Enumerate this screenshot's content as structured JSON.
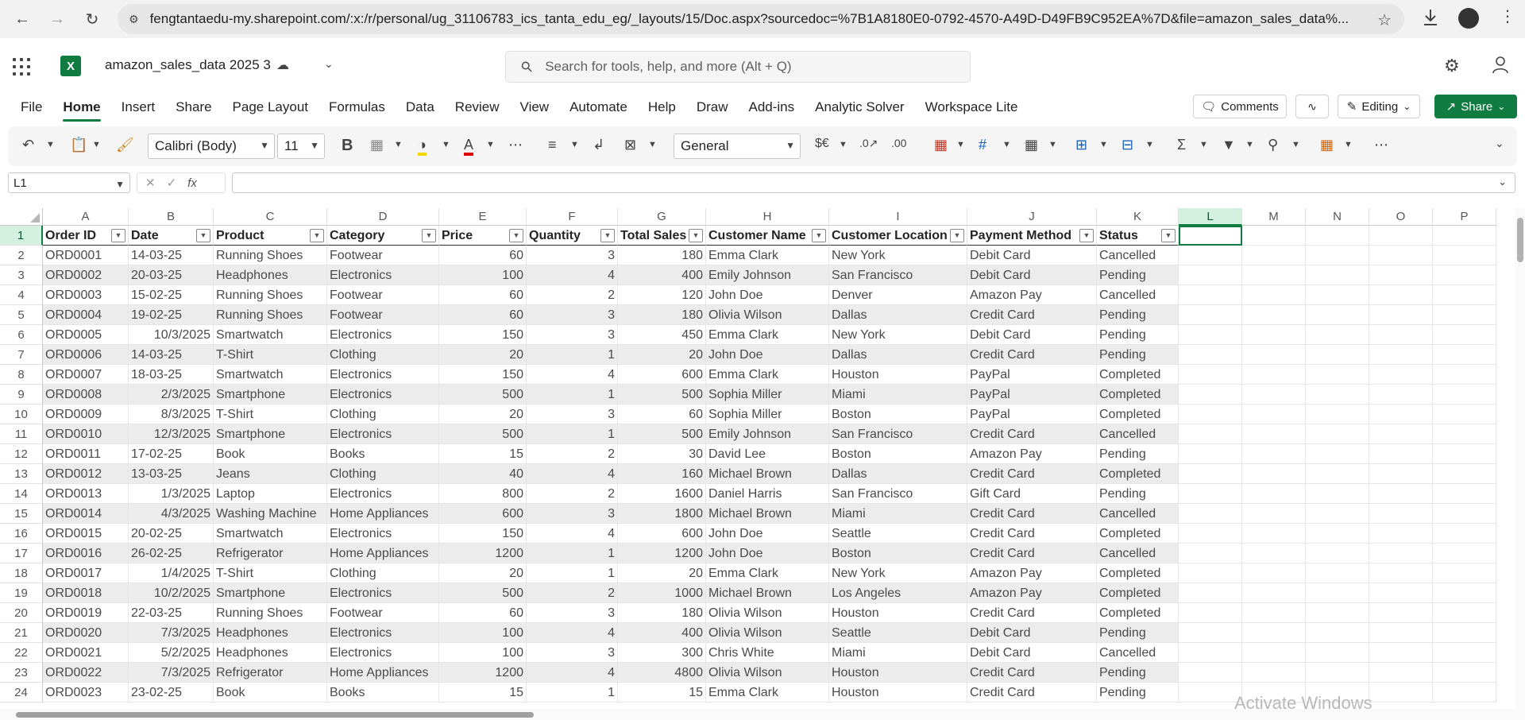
{
  "browser": {
    "url": "fengtantaedu-my.sharepoint.com/:x:/r/personal/ug_31106783_ics_tanta_edu_eg/_layouts/15/Doc.aspx?sourcedoc=%7B1A8180E0-0792-4570-A49D-D49FB9C952EA%7D&file=amazon_sales_data%..."
  },
  "app": {
    "doc_title": "amazon_sales_data 2025 3",
    "search_placeholder": "Search for tools, help, and more (Alt + Q)"
  },
  "menu": [
    "File",
    "Home",
    "Insert",
    "Share",
    "Page Layout",
    "Formulas",
    "Data",
    "Review",
    "View",
    "Automate",
    "Help",
    "Draw",
    "Add-ins",
    "Analytic Solver",
    "Workspace Lite"
  ],
  "menu_active": "Home",
  "actions": {
    "comments": "Comments",
    "editing": "Editing",
    "share": "Share"
  },
  "ribbon": {
    "font": "Calibri (Body)",
    "size": "11",
    "number_format": "General",
    "currency": "$€"
  },
  "formula_bar": {
    "name_box": "L1",
    "fx": "fx",
    "value": ""
  },
  "grid": {
    "columns": [
      "A",
      "B",
      "C",
      "D",
      "E",
      "F",
      "G",
      "H",
      "I",
      "J",
      "K",
      "L",
      "M",
      "N",
      "O",
      "P"
    ],
    "selected_column": "L",
    "selected_row": "1",
    "headers": [
      "Order ID",
      "Date",
      "Product",
      "Category",
      "Price",
      "Quantity",
      "Total Sales",
      "Customer Name",
      "Customer Location",
      "Payment Method",
      "Status"
    ],
    "rows": [
      [
        "ORD0001",
        "14-03-25",
        "Running Shoes",
        "Footwear",
        "60",
        "3",
        "180",
        "Emma Clark",
        "New York",
        "Debit Card",
        "Cancelled"
      ],
      [
        "ORD0002",
        "20-03-25",
        "Headphones",
        "Electronics",
        "100",
        "4",
        "400",
        "Emily Johnson",
        "San Francisco",
        "Debit Card",
        "Pending"
      ],
      [
        "ORD0003",
        "15-02-25",
        "Running Shoes",
        "Footwear",
        "60",
        "2",
        "120",
        "John Doe",
        "Denver",
        "Amazon Pay",
        "Cancelled"
      ],
      [
        "ORD0004",
        "19-02-25",
        "Running Shoes",
        "Footwear",
        "60",
        "3",
        "180",
        "Olivia Wilson",
        "Dallas",
        "Credit Card",
        "Pending"
      ],
      [
        "ORD0005",
        "10/3/2025",
        "Smartwatch",
        "Electronics",
        "150",
        "3",
        "450",
        "Emma Clark",
        "New York",
        "Debit Card",
        "Pending"
      ],
      [
        "ORD0006",
        "14-03-25",
        "T-Shirt",
        "Clothing",
        "20",
        "1",
        "20",
        "John Doe",
        "Dallas",
        "Credit Card",
        "Pending"
      ],
      [
        "ORD0007",
        "18-03-25",
        "Smartwatch",
        "Electronics",
        "150",
        "4",
        "600",
        "Emma Clark",
        "Houston",
        "PayPal",
        "Completed"
      ],
      [
        "ORD0008",
        "2/3/2025",
        "Smartphone",
        "Electronics",
        "500",
        "1",
        "500",
        "Sophia Miller",
        "Miami",
        "PayPal",
        "Completed"
      ],
      [
        "ORD0009",
        "8/3/2025",
        "T-Shirt",
        "Clothing",
        "20",
        "3",
        "60",
        "Sophia Miller",
        "Boston",
        "PayPal",
        "Completed"
      ],
      [
        "ORD0010",
        "12/3/2025",
        "Smartphone",
        "Electronics",
        "500",
        "1",
        "500",
        "Emily Johnson",
        "San Francisco",
        "Credit Card",
        "Cancelled"
      ],
      [
        "ORD0011",
        "17-02-25",
        "Book",
        "Books",
        "15",
        "2",
        "30",
        "David Lee",
        "Boston",
        "Amazon Pay",
        "Pending"
      ],
      [
        "ORD0012",
        "13-03-25",
        "Jeans",
        "Clothing",
        "40",
        "4",
        "160",
        "Michael Brown",
        "Dallas",
        "Credit Card",
        "Completed"
      ],
      [
        "ORD0013",
        "1/3/2025",
        "Laptop",
        "Electronics",
        "800",
        "2",
        "1600",
        "Daniel Harris",
        "San Francisco",
        "Gift Card",
        "Pending"
      ],
      [
        "ORD0014",
        "4/3/2025",
        "Washing Machine",
        "Home Appliances",
        "600",
        "3",
        "1800",
        "Michael Brown",
        "Miami",
        "Credit Card",
        "Cancelled"
      ],
      [
        "ORD0015",
        "20-02-25",
        "Smartwatch",
        "Electronics",
        "150",
        "4",
        "600",
        "John Doe",
        "Seattle",
        "Credit Card",
        "Completed"
      ],
      [
        "ORD0016",
        "26-02-25",
        "Refrigerator",
        "Home Appliances",
        "1200",
        "1",
        "1200",
        "John Doe",
        "Boston",
        "Credit Card",
        "Cancelled"
      ],
      [
        "ORD0017",
        "1/4/2025",
        "T-Shirt",
        "Clothing",
        "20",
        "1",
        "20",
        "Emma Clark",
        "New York",
        "Amazon Pay",
        "Completed"
      ],
      [
        "ORD0018",
        "10/2/2025",
        "Smartphone",
        "Electronics",
        "500",
        "2",
        "1000",
        "Michael Brown",
        "Los Angeles",
        "Amazon Pay",
        "Completed"
      ],
      [
        "ORD0019",
        "22-03-25",
        "Running Shoes",
        "Footwear",
        "60",
        "3",
        "180",
        "Olivia Wilson",
        "Houston",
        "Credit Card",
        "Completed"
      ],
      [
        "ORD0020",
        "7/3/2025",
        "Headphones",
        "Electronics",
        "100",
        "4",
        "400",
        "Olivia Wilson",
        "Seattle",
        "Debit Card",
        "Pending"
      ],
      [
        "ORD0021",
        "5/2/2025",
        "Headphones",
        "Electronics",
        "100",
        "3",
        "300",
        "Chris White",
        "Miami",
        "Debit Card",
        "Cancelled"
      ],
      [
        "ORD0022",
        "7/3/2025",
        "Refrigerator",
        "Home Appliances",
        "1200",
        "4",
        "4800",
        "Olivia Wilson",
        "Houston",
        "Credit Card",
        "Pending"
      ],
      [
        "ORD0023",
        "23-02-25",
        "Book",
        "Books",
        "15",
        "1",
        "15",
        "Emma Clark",
        "Houston",
        "Credit Card",
        "Pending"
      ]
    ]
  },
  "watermark": "Activate Windows",
  "colors": {
    "accent": "#107c41",
    "selected_header": "#d3f0e0",
    "stripe": "#ececec"
  }
}
